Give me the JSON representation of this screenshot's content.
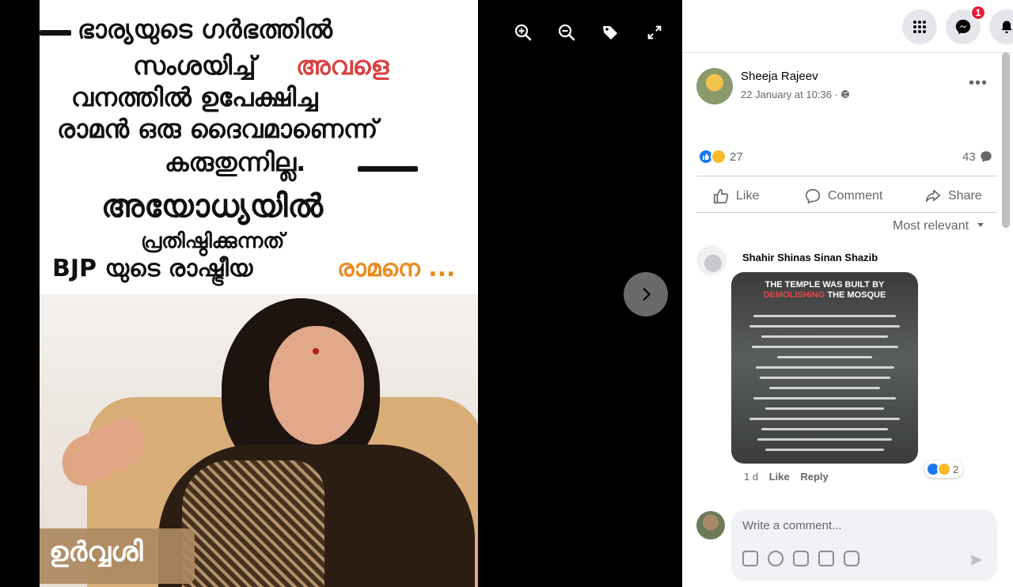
{
  "photo": {
    "line1": "ഭാര്യയുടെ ഗർഭത്തിൽ",
    "line2a": "സംശയിച്ച്",
    "line2b": "അവളെ",
    "line3": "വനത്തിൽ ഉപേക്ഷിച്ച",
    "line4": "രാമൻ ഒരു ദൈവമാണെന്ന്",
    "line5": "കരുതുന്നില്ല.",
    "line6": "അയോധ്യയിൽ",
    "line7": "പ്രതിഷ്ഠിക്കുന്നത്",
    "line8a": "BJP യുടെ രാഷ്ട്രീയ",
    "line8b": "രാമനെ ...",
    "name_badge": "ഉർവ്വശി"
  },
  "toolbar": {
    "icons": [
      "zoom-in-icon",
      "zoom-out-icon",
      "tag-icon",
      "fullscreen-icon"
    ]
  },
  "topbar": {
    "notification_count": "1"
  },
  "post": {
    "author": "Sheeja Rajeev",
    "timestamp": "22 January at 10:36 ·",
    "reaction_count": "27",
    "comment_count": "43",
    "actions": {
      "like": "Like",
      "comment": "Comment",
      "share": "Share"
    },
    "sort_label": "Most relevant"
  },
  "comment": {
    "author": "Shahir Shinas Sinan Shazib",
    "image_title_1": "THE TEMPLE WAS BUILT BY",
    "image_title_2a": "DEMOLISHING",
    "image_title_2b": "THE MOSQUE",
    "age": "1 d",
    "like": "Like",
    "reply": "Reply",
    "reaction_count": "2"
  },
  "composer": {
    "placeholder": "Write a comment..."
  },
  "colors": {
    "red_text": "#d9413f",
    "orange_text": "#ea8a1c",
    "badge_red": "#e41e3f",
    "like_blue": "#1877f2",
    "haha_yellow": "#f7b928"
  }
}
